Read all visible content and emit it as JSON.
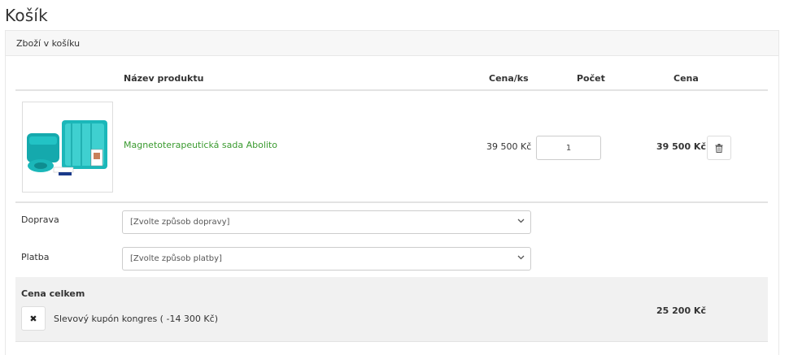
{
  "page": {
    "title": "Košík"
  },
  "panel": {
    "heading": "Zboží v košíku"
  },
  "table": {
    "headers": {
      "name": "Název produktu",
      "unit_price": "Cena/ks",
      "quantity": "Počet",
      "price": "Cena"
    },
    "rows": [
      {
        "name": "Magnetoterapeutická sada Abolito",
        "unit_price": "39 500 Kč",
        "quantity": "1",
        "price": "39 500 Kč"
      }
    ]
  },
  "shipping": {
    "label": "Doprava",
    "selected": "[Zvolte způsob dopravy]"
  },
  "payment": {
    "label": "Platba",
    "selected": "[Zvolte způsob platby]"
  },
  "summary": {
    "total_label": "Cena celkem",
    "coupon_text": "Slevový kupón kongres ( -14 300 Kč)",
    "coupon_remove": "✖",
    "total": "25 200 Kč"
  },
  "icons": {
    "delete": "trash-icon",
    "dropdown": "chevron-down-icon",
    "remove": "close-icon"
  },
  "colors": {
    "product_link": "#3a9a2f",
    "product_teal": "#1bb7b9",
    "total_bg": "#f1f1f1"
  }
}
